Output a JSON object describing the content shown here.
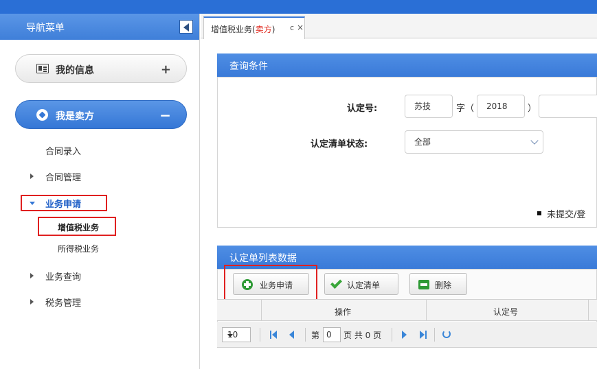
{
  "sidebar": {
    "title": "导航菜单",
    "my_info": "我的信息",
    "i_am_seller": "我是卖方",
    "items": [
      {
        "label": "合同录入"
      },
      {
        "label": "合同管理"
      },
      {
        "label": "业务申请"
      },
      {
        "label": "增值税业务"
      },
      {
        "label": "所得税业务"
      },
      {
        "label": "业务查询"
      },
      {
        "label": "税务管理"
      }
    ]
  },
  "tab": {
    "label_prefix": "增值税业务(",
    "label_red": "卖方",
    "label_suffix": ")",
    "refresh_glyph": "c",
    "close_glyph": "×"
  },
  "query": {
    "title": "查询条件",
    "cert_no_label": "认定号:",
    "cert_prefix": "苏技",
    "zi_text": "字（",
    "year": "2018",
    "close_paren": "）",
    "status_label": "认定清单状态:",
    "status_value": "全部",
    "legend_text": "未提交/登"
  },
  "list": {
    "title": "认定单列表数据",
    "btn_apply": "业务申请",
    "btn_confirm": "认定清单",
    "btn_delete": "删除",
    "col_action": "操作",
    "col_cert_no": "认定号"
  },
  "pager": {
    "page_size": "10",
    "page_prefix": "第",
    "page_value": "0",
    "page_total": "页 共 0 页"
  },
  "colors": {
    "accent": "#3a7ad8",
    "highlight": "#e02020"
  }
}
